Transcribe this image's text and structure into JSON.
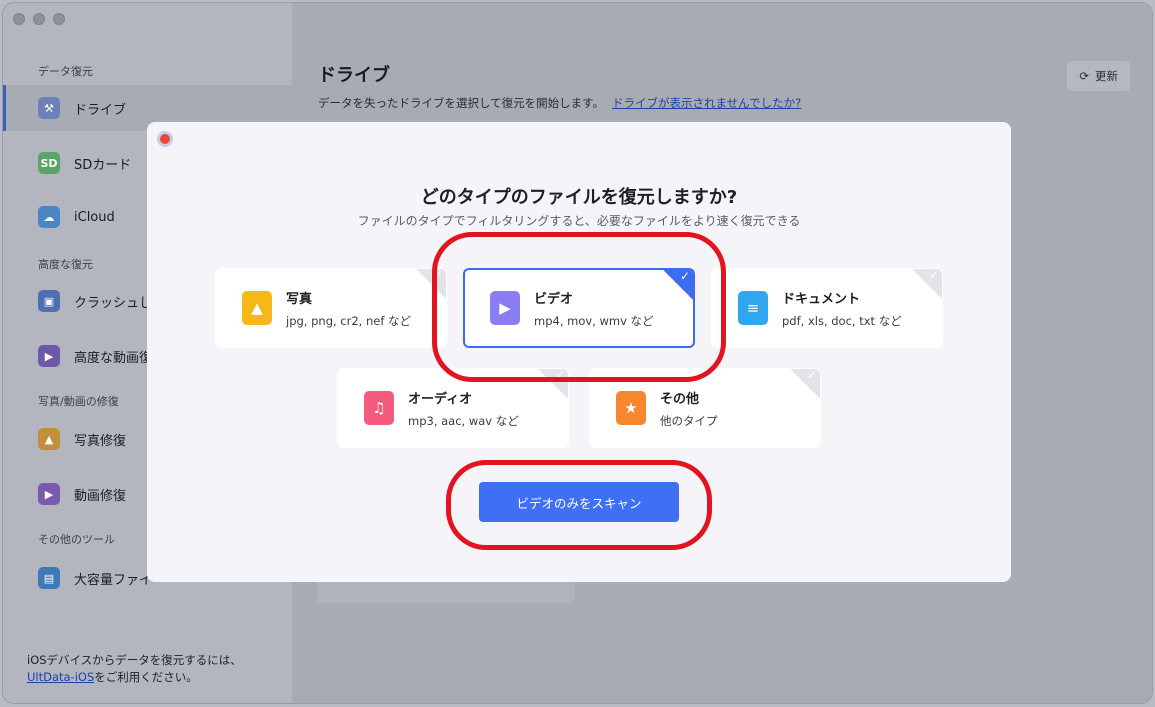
{
  "window": {
    "title": ""
  },
  "sidebar": {
    "section_recovery": "データ復元",
    "section_advanced": "高度な復元",
    "section_repair": "写真/動画の修復",
    "section_other": "その他のツール",
    "items": [
      {
        "label": "ドライブ",
        "icon": "drive-icon"
      },
      {
        "label": "SDカード",
        "icon": "sd-card-icon"
      },
      {
        "label": "iCloud",
        "icon": "icloud-icon"
      },
      {
        "label": "クラッシュし",
        "icon": "crash-computer-icon"
      },
      {
        "label": "高度な動画復",
        "icon": "advanced-video-icon"
      },
      {
        "label": "写真修復",
        "icon": "photo-repair-icon"
      },
      {
        "label": "動画修復",
        "icon": "video-repair-icon"
      },
      {
        "label": "大容量ファイ",
        "icon": "large-file-icon"
      }
    ],
    "footer_text": "iOSデバイスからデータを復元するには、",
    "footer_link": "UltData-iOS",
    "footer_suffix": "をご利用ください。"
  },
  "main": {
    "title": "ドライブ",
    "subtitle": "データを失ったドライブを選択して復元を開始します。",
    "subtitle_link": "ドライブが表示されませんでしたか?",
    "refresh_label": "更新"
  },
  "modal": {
    "title": "どのタイプのファイルを復元しますか?",
    "subtitle": "ファイルのタイプでフィルタリングすると、必要なファイルをより速く復元できる",
    "types": [
      {
        "name": "写真",
        "desc": "jpg, png, cr2, nef など",
        "icon": "image-file-icon",
        "color": "#f5b816",
        "selected": false
      },
      {
        "name": "ビデオ",
        "desc": "mp4, mov, wmv など",
        "icon": "video-file-icon",
        "color": "#8a7df2",
        "selected": true
      },
      {
        "name": "ドキュメント",
        "desc": "pdf, xls, doc, txt など",
        "icon": "document-file-icon",
        "color": "#2fa7ee",
        "selected": false
      },
      {
        "name": "オーディオ",
        "desc": "mp3, aac, wav など",
        "icon": "audio-file-icon",
        "color": "#f45b7c",
        "selected": false
      },
      {
        "name": "その他",
        "desc": "他のタイプ",
        "icon": "other-file-icon",
        "color": "#f6872f",
        "selected": false
      }
    ],
    "scan_label": "ビデオのみをスキャン",
    "check_mark": "✓"
  },
  "colors": {
    "accent": "#3f6ff5",
    "highlight": "#e3141f"
  }
}
